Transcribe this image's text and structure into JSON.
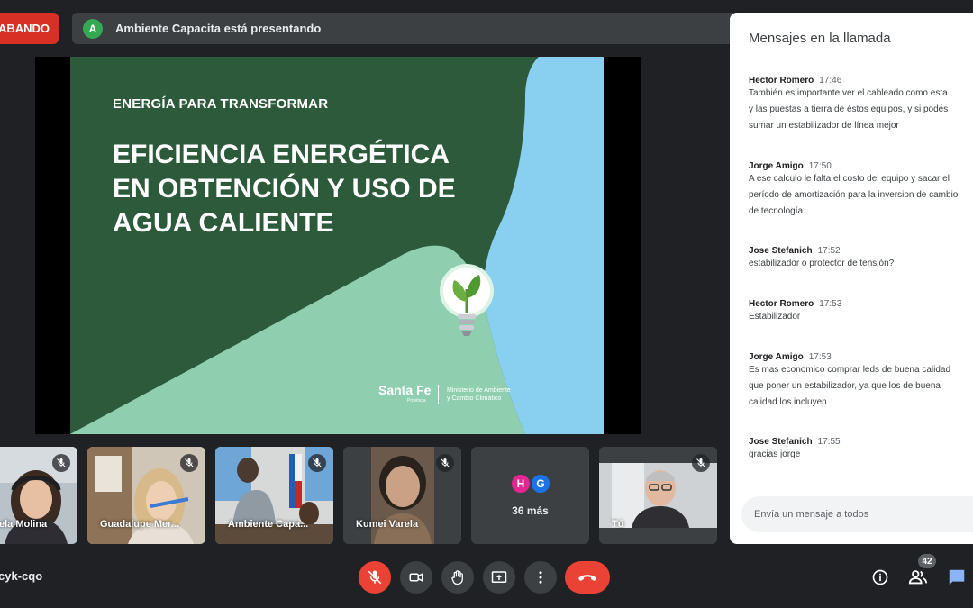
{
  "recording": {
    "label": "ABANDO"
  },
  "presenting": {
    "avatar_letter": "A",
    "text": "Ambiente Capacita está presentando"
  },
  "slide": {
    "kicker": "ENERGÍA PARA TRANSFORMAR",
    "title_lines": [
      "EFICIENCIA ENERGÉTICA",
      "EN OBTENCIÓN Y USO DE",
      "AGUA CALIENTE"
    ],
    "logo": "Santa Fe",
    "logo_sub": "Provincia",
    "ministry": [
      "Ministerio de Ambiente",
      "y Cambio Climático"
    ]
  },
  "participants": [
    {
      "name": "ela Molina"
    },
    {
      "name": "Guadalupe Mer..."
    },
    {
      "name": "Ambiente Capa..."
    },
    {
      "name": "Kumei Varela"
    },
    {
      "more_label": "36 más",
      "avatars": [
        "H",
        "G"
      ]
    },
    {
      "name": "Tú"
    }
  ],
  "chat": {
    "title": "Mensajes en la llamada",
    "messages": [
      {
        "author": "Hector Romero",
        "time": "17:46",
        "lines": [
          "También es importante ver el cableado como esta",
          "y las puestas a tierra de éstos equipos, y si podés",
          "sumar un estabilizador de línea mejor"
        ]
      },
      {
        "author": "Jorge Amigo",
        "time": "17:50",
        "lines": [
          "A ese calculo le falta el costo del equipo y sacar el",
          "período de amortización para la inversion de cambio",
          "de tecnología."
        ]
      },
      {
        "author": "Jose Stefanich",
        "time": "17:52",
        "lines": [
          "estabilizador o protector de tensión?"
        ]
      },
      {
        "author": "Hector Romero",
        "time": "17:53",
        "lines": [
          "Estabilizador"
        ]
      },
      {
        "author": "Jorge Amigo",
        "time": "17:53",
        "lines": [
          "Es mas economico comprar leds de buena calidad",
          "que poner un estabilizador, ya que los de buena",
          "calidad los incluyen"
        ]
      },
      {
        "author": "Jose Stefanich",
        "time": "17:55",
        "lines": [
          "gracias jorge"
        ]
      }
    ],
    "input_placeholder": "Envía un mensaje a todos"
  },
  "meeting_code": "cyk-cqo",
  "people_count": "42",
  "colors": {
    "accent_red": "#ea4335",
    "chat_blue": "#8ab4f8",
    "slide_green": "#2c5a3a",
    "slide_light": "#8fcfb0",
    "slide_sky": "#89cff0"
  },
  "icons": [
    "mic-off-icon",
    "camera-icon",
    "hand-icon",
    "present-icon",
    "more-icon",
    "hangup-icon",
    "info-icon",
    "people-icon",
    "chat-icon"
  ]
}
